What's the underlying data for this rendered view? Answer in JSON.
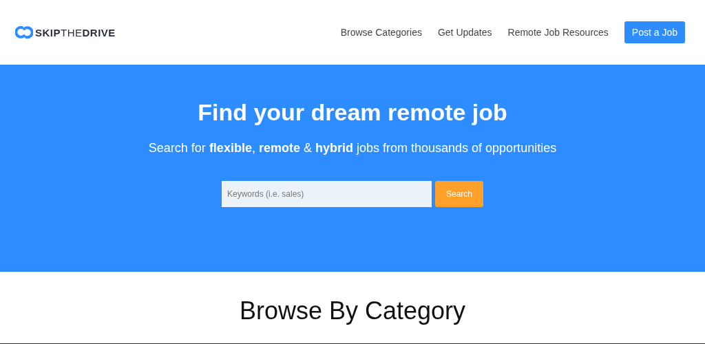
{
  "header": {
    "logo": "**SKIP**THE**DRIVE**",
    "nav": [
      {
        "label": "Browse Categories",
        "kind": "link"
      },
      {
        "label": "Get Updates",
        "kind": "link"
      },
      {
        "label": "Remote Job Resources",
        "kind": "link"
      },
      {
        "label": "Post a Job",
        "kind": "button"
      }
    ]
  },
  "hero": {
    "title": "Find your dream remote job",
    "subtitle": "Search for **flexible**, **remote** & **hybrid** jobs from thousands of opportunities",
    "search": {
      "placeholder": "Keywords (i.e. sales)",
      "button": "Search"
    }
  },
  "section": {
    "title": "Browse By Category"
  }
}
